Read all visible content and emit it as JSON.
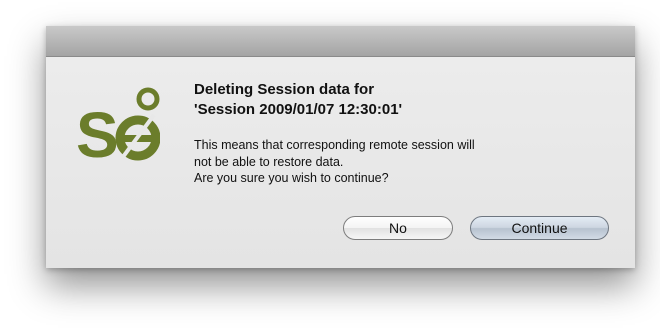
{
  "dialog": {
    "headline_line1": "Deleting Session data for",
    "headline_line2": "'Session 2009/01/07 12:30:01'",
    "message_line1": "This means that corresponding remote session will",
    "message_line2": "not be able to restore data.",
    "message_line3": "Are you sure you wish to continue?",
    "logo_icon": "selenium-logo-icon",
    "logo_color": "#6b7d2b"
  },
  "buttons": {
    "no_label": "No",
    "continue_label": "Continue"
  }
}
